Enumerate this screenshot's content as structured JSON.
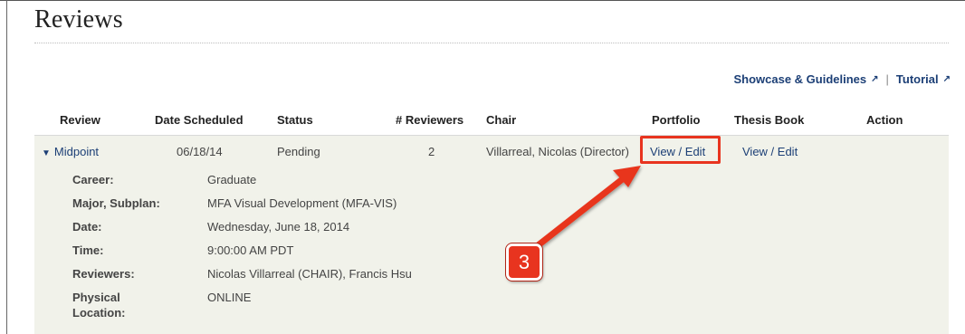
{
  "page": {
    "title": "Reviews"
  },
  "links": {
    "showcase": "Showcase & Guidelines",
    "separator": "|",
    "tutorial": "Tutorial",
    "external_icon": "external-link-icon"
  },
  "table": {
    "headers": {
      "review": "Review",
      "date_scheduled": "Date Scheduled",
      "status": "Status",
      "reviewers": "# Reviewers",
      "chair": "Chair",
      "portfolio": "Portfolio",
      "thesis_book": "Thesis Book",
      "action": "Action"
    },
    "row": {
      "toggle_icon": "triangle-down-icon",
      "review": "Midpoint",
      "date_scheduled": "06/18/14",
      "status": "Pending",
      "reviewers": "2",
      "chair": "Villarreal, Nicolas (Director)",
      "portfolio": "View / Edit",
      "thesis_book": "View / Edit"
    },
    "details": {
      "career_label": "Career:",
      "career_value": "Graduate",
      "major_label": "Major, Subplan:",
      "major_value": "MFA Visual Development (MFA-VIS)",
      "date_label": "Date:",
      "date_value": "Wednesday, June 18, 2014",
      "time_label": "Time:",
      "time_value": "9:00:00 AM PDT",
      "reviewers_label": "Reviewers:",
      "reviewers_value": "Nicolas Villarreal (CHAIR), Francis Hsu",
      "location_label_line1": "Physical",
      "location_label_line2": "Location:",
      "location_value": "ONLINE"
    }
  },
  "annotation": {
    "step_number": "3",
    "color": "#e8341f"
  }
}
